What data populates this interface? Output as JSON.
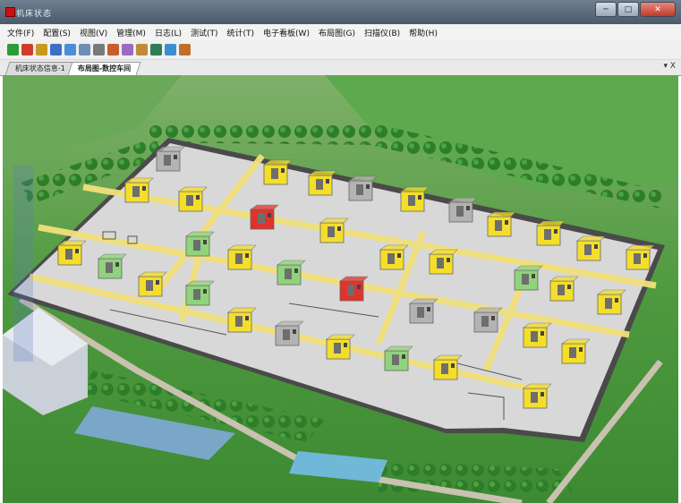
{
  "window": {
    "title": "机床状态",
    "controls": {
      "minimize": "─",
      "maximize": "□",
      "close": "✕"
    }
  },
  "menu": [
    "文件(F)",
    "配置(S)",
    "视图(V)",
    "管理(M)",
    "日志(L)",
    "测试(T)",
    "统计(T)",
    "电子看板(W)",
    "布局图(G)",
    "扫描仪(B)",
    "帮助(H)"
  ],
  "toolbar": {
    "icons": [
      "start-icon",
      "stop-icon",
      "tool-icon",
      "cut-icon",
      "list-icon",
      "table-icon",
      "edit-icon",
      "chart-icon",
      "settings-icon",
      "barcode-icon",
      "filter-icon",
      "search-icon",
      "person-icon"
    ],
    "colors": [
      "#2e9b36",
      "#d23b2b",
      "#c79a1c",
      "#3c6fc6",
      "#4b8fd6",
      "#6c8fb4",
      "#7a7a7a",
      "#c65f2b",
      "#9a6bc0",
      "#c08a3a",
      "#2f7d54",
      "#3a8fd0",
      "#c06f2b"
    ]
  },
  "tabs": [
    {
      "label": "机床状态信息-1",
      "active": false
    },
    {
      "label": "布局图-数控车间",
      "active": true
    }
  ],
  "tab_controls": "▾ X",
  "layout_legend_colors": {
    "running": "#f4de2a",
    "idle": "#8fd47a",
    "alarm": "#e0332c",
    "offline": "#b3b3b3"
  },
  "machines": [
    {
      "status": "offline"
    },
    {
      "status": "running"
    },
    {
      "status": "running"
    },
    {
      "status": "running"
    },
    {
      "status": "running"
    },
    {
      "status": "offline"
    },
    {
      "status": "running"
    },
    {
      "status": "offline"
    },
    {
      "status": "alarm"
    },
    {
      "status": "running"
    },
    {
      "status": "running"
    },
    {
      "status": "idle"
    },
    {
      "status": "running"
    },
    {
      "status": "running"
    },
    {
      "status": "idle"
    },
    {
      "status": "idle"
    },
    {
      "status": "running"
    },
    {
      "status": "running"
    },
    {
      "status": "running"
    },
    {
      "status": "running"
    },
    {
      "status": "running"
    },
    {
      "status": "alarm"
    },
    {
      "status": "running"
    },
    {
      "status": "idle"
    },
    {
      "status": "idle"
    },
    {
      "status": "running"
    },
    {
      "status": "offline"
    },
    {
      "status": "offline"
    },
    {
      "status": "running"
    },
    {
      "status": "running"
    },
    {
      "status": "offline"
    },
    {
      "status": "running"
    },
    {
      "status": "running"
    },
    {
      "status": "idle"
    },
    {
      "status": "running"
    },
    {
      "status": "running"
    },
    {
      "status": "running"
    }
  ]
}
